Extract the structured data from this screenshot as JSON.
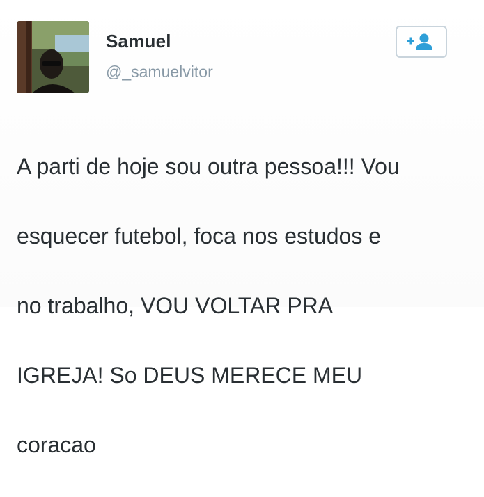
{
  "user": {
    "display_name": "Samuel",
    "handle": "@_samuelvitor"
  },
  "follow_button": {
    "icon": "add-user-icon",
    "color": "#2e9fd8"
  },
  "tweet": {
    "lines": [
      "A parti de hoje sou outra pessoa!!! Vou",
      "esquecer futebol, foca nos estudos e",
      "no trabalho, VOU VOLTAR PRA",
      "IGREJA! So DEUS MERECE MEU",
      "coracao"
    ]
  }
}
